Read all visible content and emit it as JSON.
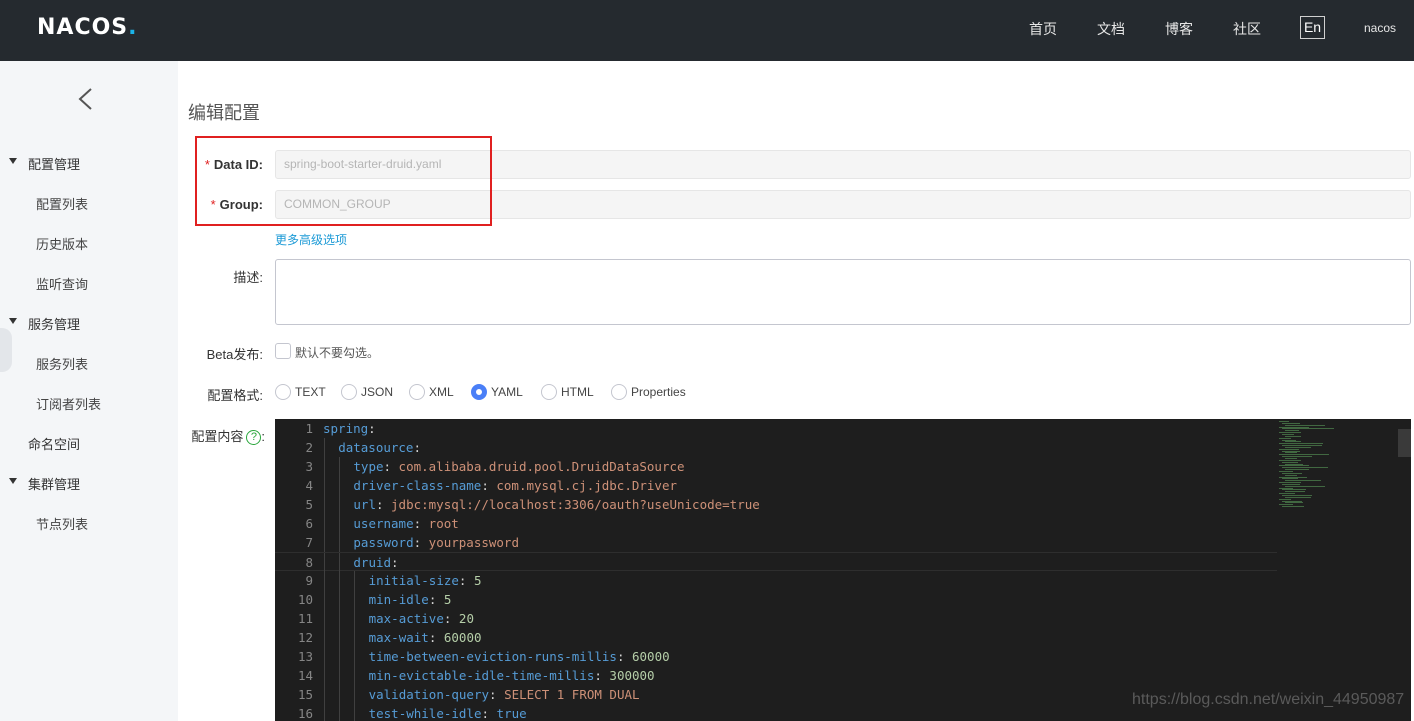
{
  "header": {
    "logo": "NACOS",
    "logo_dot": ".",
    "nav": [
      "首页",
      "文档",
      "博客",
      "社区"
    ],
    "lang": "En",
    "user": "nacos"
  },
  "sidebar": {
    "groups": [
      {
        "label": "配置管理",
        "items": [
          "配置列表",
          "历史版本",
          "监听查询"
        ]
      },
      {
        "label": "服务管理",
        "items": [
          "服务列表",
          "订阅者列表"
        ]
      },
      {
        "label": "命名空间",
        "items": []
      },
      {
        "label": "集群管理",
        "items": [
          "节点列表"
        ]
      }
    ]
  },
  "page": {
    "title": "编辑配置",
    "data_id_label": "Data ID:",
    "data_id_value": "spring-boot-starter-druid.yaml",
    "group_label": "Group:",
    "group_value": "COMMON_GROUP",
    "advanced_link": "更多高级选项",
    "description_label": "描述:",
    "beta_label": "Beta发布:",
    "beta_hint": "默认不要勾选。",
    "format_label": "配置格式:",
    "formats": [
      "TEXT",
      "JSON",
      "XML",
      "YAML",
      "HTML",
      "Properties"
    ],
    "selected_format": "YAML",
    "content_label": "配置内容",
    "content_help": "?",
    "content_colon": ":"
  },
  "editor": {
    "lines": [
      {
        "n": "1",
        "indent": 0,
        "key": "spring",
        "val": "",
        "type": ""
      },
      {
        "n": "2",
        "indent": 1,
        "key": "datasource",
        "val": "",
        "type": ""
      },
      {
        "n": "3",
        "indent": 2,
        "key": "type",
        "val": "com.alibaba.druid.pool.DruidDataSource",
        "type": "s"
      },
      {
        "n": "4",
        "indent": 2,
        "key": "driver-class-name",
        "val": "com.mysql.cj.jdbc.Driver",
        "type": "s"
      },
      {
        "n": "5",
        "indent": 2,
        "key": "url",
        "val": "jdbc:mysql://localhost:3306/oauth?useUnicode=true",
        "type": "s"
      },
      {
        "n": "6",
        "indent": 2,
        "key": "username",
        "val": "root",
        "type": "s"
      },
      {
        "n": "7",
        "indent": 2,
        "key": "password",
        "val": "yourpassword",
        "type": "s"
      },
      {
        "n": "8",
        "indent": 2,
        "key": "druid",
        "val": "",
        "type": ""
      },
      {
        "n": "9",
        "indent": 3,
        "key": "initial-size",
        "val": "5",
        "type": "n"
      },
      {
        "n": "10",
        "indent": 3,
        "key": "min-idle",
        "val": "5",
        "type": "n"
      },
      {
        "n": "11",
        "indent": 3,
        "key": "max-active",
        "val": "20",
        "type": "n"
      },
      {
        "n": "12",
        "indent": 3,
        "key": "max-wait",
        "val": "60000",
        "type": "n"
      },
      {
        "n": "13",
        "indent": 3,
        "key": "time-between-eviction-runs-millis",
        "val": "60000",
        "type": "n"
      },
      {
        "n": "14",
        "indent": 3,
        "key": "min-evictable-idle-time-millis",
        "val": "300000",
        "type": "n"
      },
      {
        "n": "15",
        "indent": 3,
        "key": "validation-query",
        "val": "SELECT 1 FROM DUAL",
        "type": "s"
      },
      {
        "n": "16",
        "indent": 3,
        "key": "test-while-idle",
        "val": "true",
        "type": "b"
      }
    ],
    "active_line": "8"
  },
  "watermark": "https://blog.csdn.net/weixin_44950987",
  "colors": {
    "header_bg": "#252a2f",
    "sidebar_bg": "#f4f6f8",
    "editor_bg": "#1e1e1e",
    "highlight": "#e02020",
    "radio_selected": "#4a7ff7",
    "link": "#1c9ad6"
  }
}
